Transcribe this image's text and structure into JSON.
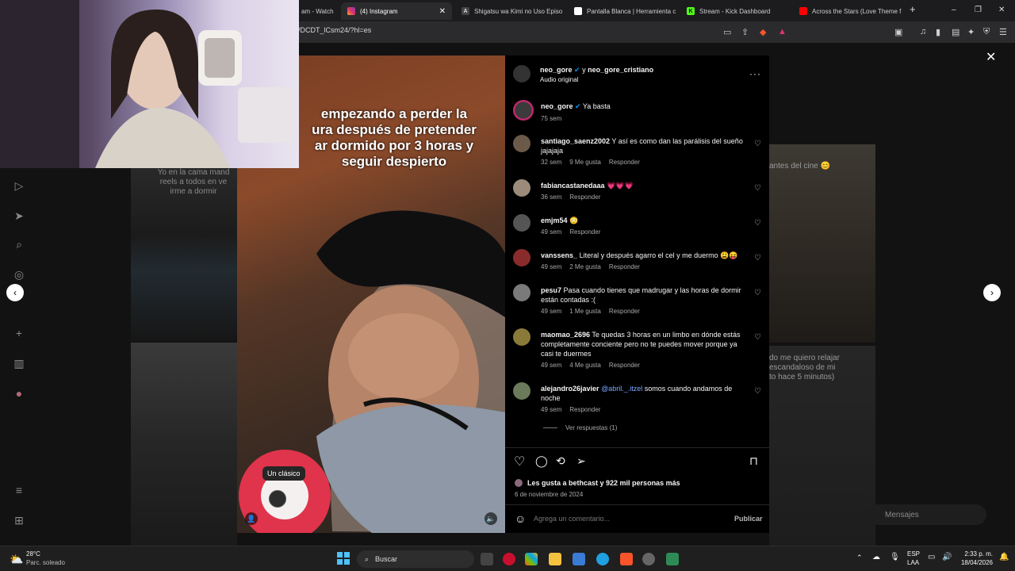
{
  "browser": {
    "tabs": [
      {
        "label": "am - Watch",
        "active": false
      },
      {
        "label": "(4) Instagram",
        "active": true
      },
      {
        "label": "Shigatsu wa Kimi no Uso Episo",
        "active": false
      },
      {
        "label": "Pantalla Blanca | Herramienta c",
        "active": false
      },
      {
        "label": "Stream - Kick Dashboard",
        "active": false
      },
      {
        "label": "Across the Stars (Love Theme f",
        "active": false
      }
    ],
    "url": "/DCDT_lCsm24/?hl=es"
  },
  "post": {
    "author": "neo_gore",
    "author_joiner": "y",
    "coauthor": "neo_gore_cristiano",
    "audio": "Audio original",
    "overlay_text": "empezando a perder la\nura después de pretender\nar dormido por 3 horas y\nseguir despierto",
    "caption": {
      "user": "neo_gore",
      "text": "Ya basta",
      "age": "75 sem"
    },
    "video_label": "Un clásico",
    "likes_text": "Les gusta a bethcast y 922 mil personas más",
    "date": "6 de noviembre de 2024",
    "comment_placeholder": "Agrega un comentario...",
    "publish_label": "Publicar",
    "view_replies": "Ver respuestas (1)",
    "reply_label": "Responder"
  },
  "comments": [
    {
      "user": "santiago_saenz2002",
      "text": "Y así es como dan las parálisis del sueño jajajaja",
      "age": "32 sem",
      "likes": "9 Me gusta"
    },
    {
      "user": "fabiancastanedaaa",
      "text": "💗💗💗",
      "age": "36 sem",
      "likes": ""
    },
    {
      "user": "emjm54",
      "text": "😳",
      "age": "49 sem",
      "likes": ""
    },
    {
      "user": "vanssens_",
      "text": "Literal y después agarro el cel y me duermo 😩😝",
      "age": "49 sem",
      "likes": "2 Me gusta"
    },
    {
      "user": "pesu7",
      "text": "Pasa cuando tienes que madrugar y las horas de dormir están contadas :(",
      "age": "49 sem",
      "likes": "1 Me gusta"
    },
    {
      "user": "maomao_2696",
      "text": "Te quedas 3 horas en un limbo en dónde estás completamente conciente pero no te puedes mover porque ya casi te duermes",
      "age": "49 sem",
      "likes": "4 Me gusta"
    },
    {
      "user": "alejandro26javier",
      "mention": "@abril._.itzel",
      "text": "somos cuando andamos de noche",
      "age": "49 sem",
      "likes": ""
    }
  ],
  "background": {
    "left_reel_text": "Yo en la cama mand\nreels a todos en ve\nirme a dormir",
    "right_reel_top_text": "antes del cine 😊",
    "right_reel_bottom_text": "do me quiero relajar\nescandaloso de mi\nto hace 5 minutos)",
    "messages_label": "Mensajes"
  },
  "taskbar": {
    "weather_temp": "28°C",
    "weather_desc": "Parc. soleado",
    "search_label": "Buscar",
    "lang": "ESP",
    "lang2": "LAA",
    "time": "2:33 p. m.",
    "date": "18/04/2026"
  },
  "colors": {
    "accent": "#0095f6",
    "verified": "#0095f6",
    "notification": "#ff3040"
  }
}
